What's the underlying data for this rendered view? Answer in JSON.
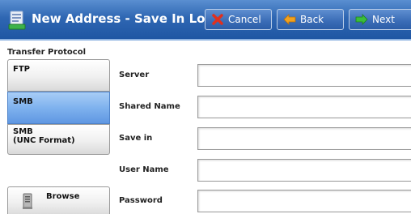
{
  "titlebar": {
    "title": "New Address - Save In Location",
    "icon": "address-book-icon",
    "cancel_label": "Cancel",
    "back_label": "Back",
    "next_label": "Next"
  },
  "transfer": {
    "section_label": "Transfer Protocol",
    "options": [
      "FTP",
      "SMB",
      "SMB",
      "(UNC Format)"
    ],
    "selected": "SMB"
  },
  "browse": {
    "label": "Browse",
    "icon": "server-icon"
  },
  "fields": {
    "server_label": "Server",
    "shared_name_label": "Shared Name",
    "save_in_label": "Save in",
    "user_name_label": "User Name",
    "password_label": "Password"
  },
  "colors": {
    "titlebar": "#2f67b3",
    "selected": "#7fb2ee"
  }
}
